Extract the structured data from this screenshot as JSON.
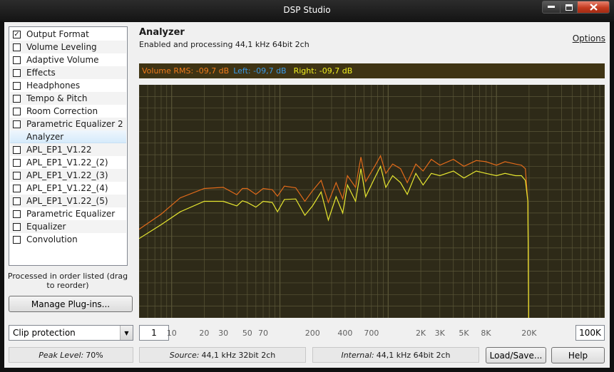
{
  "window": {
    "title": "DSP Studio"
  },
  "plugins": [
    {
      "label": "Output Format",
      "checked": true
    },
    {
      "label": "Volume Leveling",
      "checked": false
    },
    {
      "label": "Adaptive Volume",
      "checked": false
    },
    {
      "label": "Effects",
      "checked": false
    },
    {
      "label": "Headphones",
      "checked": false
    },
    {
      "label": "Tempo & Pitch",
      "checked": false
    },
    {
      "label": "Room Correction",
      "checked": false
    },
    {
      "label": "Parametric Equalizer 2",
      "checked": false
    },
    {
      "label": "Analyzer",
      "checked": null,
      "selected": true
    },
    {
      "label": "APL_EP1_V1.22",
      "checked": false
    },
    {
      "label": "APL_EP1_V1.22_(2)",
      "checked": false
    },
    {
      "label": "APL_EP1_V1.22_(3)",
      "checked": false
    },
    {
      "label": "APL_EP1_V1.22_(4)",
      "checked": false
    },
    {
      "label": "APL_EP1_V1.22_(5)",
      "checked": false
    },
    {
      "label": "Parametric Equalizer",
      "checked": false
    },
    {
      "label": "Equalizer",
      "checked": false
    },
    {
      "label": "Convolution",
      "checked": false
    }
  ],
  "order_note": "Processed in order listed (drag to reorder)",
  "manage_plugins_label": "Manage Plug-ins...",
  "analyzer": {
    "title": "Analyzer",
    "subtitle": "Enabled and processing 44,1 kHz 64bit 2ch",
    "options_label": "Options"
  },
  "rms": {
    "volume_label": "Volume RMS: -09,7 dB",
    "left_label": "Left: -09,7 dB",
    "right_label": "Right: -09,7 dB",
    "colors": {
      "volume": "#f07a1a",
      "left": "#3a9ae8",
      "right": "#f0f020"
    }
  },
  "chart_data": {
    "type": "line",
    "x_scale": "log",
    "xlim": [
      5,
      100000
    ],
    "grid": true,
    "colors": {
      "background": "#2e2a18",
      "grid": "#5a5638",
      "orange": "#e06a1a",
      "yellow": "#e6e630"
    },
    "series": [
      {
        "color": "orange",
        "points": [
          [
            5,
            0.62
          ],
          [
            8,
            0.555
          ],
          [
            12,
            0.485
          ],
          [
            20,
            0.445
          ],
          [
            30,
            0.44
          ],
          [
            40,
            0.472
          ],
          [
            45,
            0.445
          ],
          [
            50,
            0.445
          ],
          [
            60,
            0.47
          ],
          [
            70,
            0.445
          ],
          [
            85,
            0.45
          ],
          [
            95,
            0.478
          ],
          [
            110,
            0.435
          ],
          [
            140,
            0.442
          ],
          [
            170,
            0.5
          ],
          [
            200,
            0.455
          ],
          [
            240,
            0.41
          ],
          [
            280,
            0.505
          ],
          [
            330,
            0.42
          ],
          [
            380,
            0.49
          ],
          [
            420,
            0.39
          ],
          [
            500,
            0.44
          ],
          [
            560,
            0.31
          ],
          [
            620,
            0.415
          ],
          [
            750,
            0.35
          ],
          [
            850,
            0.305
          ],
          [
            950,
            0.38
          ],
          [
            1100,
            0.34
          ],
          [
            1300,
            0.36
          ],
          [
            1500,
            0.42
          ],
          [
            1800,
            0.34
          ],
          [
            2100,
            0.37
          ],
          [
            2500,
            0.32
          ],
          [
            3000,
            0.345
          ],
          [
            4000,
            0.32
          ],
          [
            5000,
            0.35
          ],
          [
            6500,
            0.325
          ],
          [
            8000,
            0.33
          ],
          [
            10000,
            0.345
          ],
          [
            12000,
            0.33
          ],
          [
            15000,
            0.34
          ],
          [
            17000,
            0.345
          ],
          [
            18500,
            0.36
          ],
          [
            19500,
            0.5
          ],
          [
            20000,
            1.25
          ]
        ]
      },
      {
        "color": "yellow",
        "points": [
          [
            5,
            0.66
          ],
          [
            8,
            0.6
          ],
          [
            12,
            0.545
          ],
          [
            20,
            0.5
          ],
          [
            30,
            0.5
          ],
          [
            40,
            0.52
          ],
          [
            45,
            0.498
          ],
          [
            50,
            0.505
          ],
          [
            60,
            0.525
          ],
          [
            70,
            0.5
          ],
          [
            85,
            0.505
          ],
          [
            95,
            0.545
          ],
          [
            110,
            0.492
          ],
          [
            140,
            0.49
          ],
          [
            170,
            0.56
          ],
          [
            200,
            0.52
          ],
          [
            240,
            0.46
          ],
          [
            280,
            0.58
          ],
          [
            330,
            0.48
          ],
          [
            380,
            0.55
          ],
          [
            420,
            0.43
          ],
          [
            500,
            0.5
          ],
          [
            560,
            0.36
          ],
          [
            620,
            0.48
          ],
          [
            750,
            0.4
          ],
          [
            850,
            0.35
          ],
          [
            950,
            0.44
          ],
          [
            1100,
            0.39
          ],
          [
            1300,
            0.42
          ],
          [
            1500,
            0.47
          ],
          [
            1800,
            0.38
          ],
          [
            2100,
            0.43
          ],
          [
            2500,
            0.38
          ],
          [
            3000,
            0.39
          ],
          [
            4000,
            0.37
          ],
          [
            5000,
            0.4
          ],
          [
            6500,
            0.37
          ],
          [
            8000,
            0.38
          ],
          [
            10000,
            0.39
          ],
          [
            12000,
            0.38
          ],
          [
            15000,
            0.39
          ],
          [
            17000,
            0.39
          ],
          [
            18500,
            0.41
          ],
          [
            19500,
            0.5
          ],
          [
            20000,
            1.25
          ]
        ]
      }
    ],
    "x_ticks": [
      "10",
      "20",
      "30",
      "50",
      "70",
      "200",
      "400",
      "700",
      "2K",
      "3K",
      "5K",
      "8K",
      "20K"
    ]
  },
  "tick_values": [
    10,
    20,
    30,
    50,
    70,
    200,
    400,
    700,
    2000,
    3000,
    5000,
    8000,
    20000
  ],
  "min_freq": "1",
  "max_freq": "100K",
  "clip_select": "Clip protection",
  "status": {
    "peak_label": "Peak Level:",
    "peak_value": "70%",
    "source_label": "Source:",
    "source_value": "44,1 kHz 32bit 2ch",
    "internal_label": "Internal:",
    "internal_value": "44,1 kHz 64bit 2ch"
  },
  "load_save_label": "Load/Save...",
  "help_label": "Help"
}
